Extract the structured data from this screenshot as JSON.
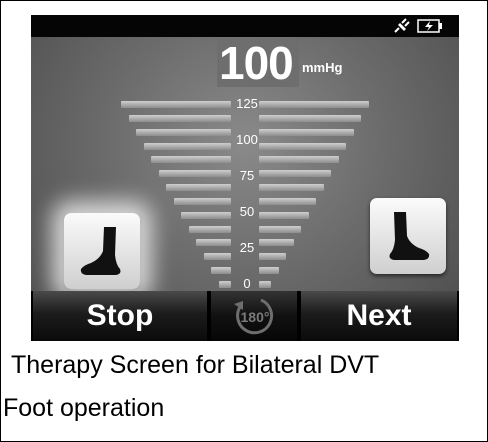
{
  "status_bar": {
    "icons": [
      "plug-icon",
      "battery-charging-icon"
    ]
  },
  "pressure": {
    "value": "100",
    "unit": "mmHg"
  },
  "scale": {
    "labels": [
      "125",
      "100",
      "75",
      "50",
      "25",
      "0"
    ],
    "level": 100,
    "max": 125
  },
  "left_foot": {
    "icon": "left-foot-icon",
    "state": "selected"
  },
  "right_foot": {
    "icon": "right-foot-icon",
    "state": "unselected"
  },
  "bottom_bar": {
    "stop_label": "Stop",
    "rotate_label": "180°",
    "next_label": "Next"
  },
  "caption": {
    "line1": "Therapy Screen for Bilateral DVT",
    "line2": "Foot operation"
  },
  "colors": {
    "status_bar": "#050505",
    "screen_bg": "#6c6c6c",
    "button_face": "#e8e8e8",
    "foot_icon": "#111111"
  }
}
